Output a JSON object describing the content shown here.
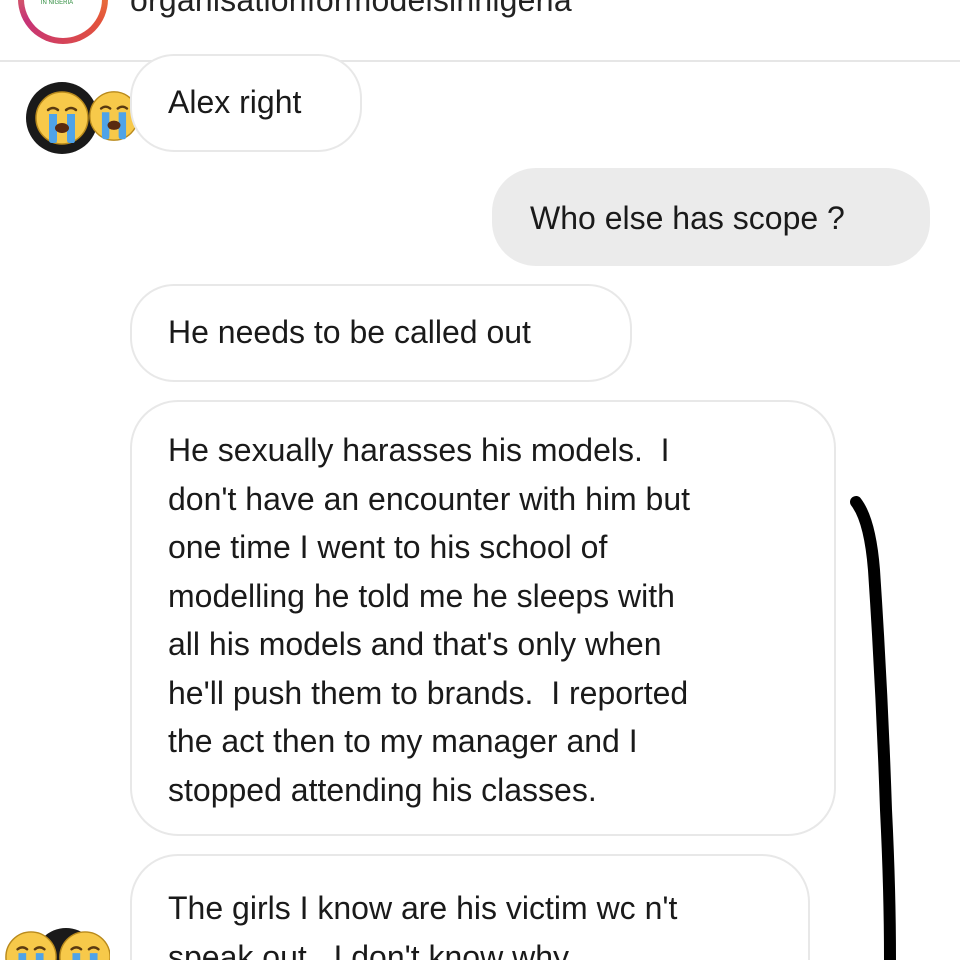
{
  "header": {
    "username": "organisationformodelsinnigeria",
    "logo_text": "IN NIGERIA"
  },
  "messages": [
    {
      "id": "m1",
      "direction": "received",
      "lines": [
        "Alex right"
      ]
    },
    {
      "id": "m2",
      "direction": "sent",
      "lines": [
        "Who else has scope ?"
      ]
    },
    {
      "id": "m3",
      "direction": "received",
      "lines": [
        "He needs to be called out"
      ]
    },
    {
      "id": "m4",
      "direction": "received",
      "lines": [
        "He sexually harasses his models.  I",
        "don't have an encounter with him but",
        "one time I went to his school of",
        "modelling he told me he sleeps with",
        "all his models and that's only when",
        "he'll push them to brands.  I reported",
        "the act then to my manager and I",
        "stopped attending his classes."
      ]
    },
    {
      "id": "m5",
      "direction": "received",
      "lines": [
        "The girls I know are his victim wc n't",
        "speak out.  I don't know why"
      ]
    }
  ],
  "reactions": {
    "top": "loudly-crying-face-emoji",
    "bottom": "loudly-crying-face-emoji"
  },
  "colors": {
    "sent_bubble": "#ebebeb",
    "received_border": "#e8e8e8",
    "annotation_ink": "#000000"
  }
}
